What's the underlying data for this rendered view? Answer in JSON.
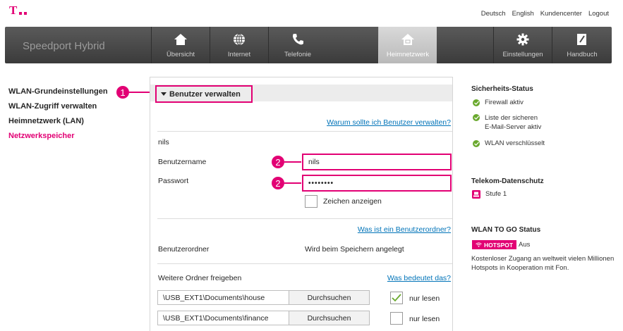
{
  "header": {
    "links": [
      "Deutsch",
      "English",
      "Kundencenter",
      "Logout"
    ]
  },
  "nav": {
    "brand": "Speedport Hybrid",
    "items": [
      {
        "label": "Übersicht",
        "icon": "home-icon"
      },
      {
        "label": "Internet",
        "icon": "globe-icon"
      },
      {
        "label": "Telefonie",
        "icon": "phone-icon"
      },
      {
        "label": "Heimnetzwerk",
        "icon": "home-network-icon",
        "active": true
      },
      {
        "label": "Einstellungen",
        "icon": "gear-icon"
      },
      {
        "label": "Handbuch",
        "icon": "book-icon"
      }
    ]
  },
  "sidebar": {
    "items": [
      {
        "label": "WLAN-Grundeinstellungen"
      },
      {
        "label": "WLAN-Zugriff verwalten"
      },
      {
        "label": "Heimnetzwerk (LAN)"
      },
      {
        "label": "Netzwerkspeicher",
        "active": true
      }
    ]
  },
  "main": {
    "section_title": "Benutzer verwalten",
    "why_link": "Warum sollte ich Benutzer verwalten?",
    "user_name_display": "nils",
    "username_label": "Benutzername",
    "username_value": "nils",
    "password_label": "Passwort",
    "password_value": "••••••••",
    "show_chars_label": "Zeichen anzeigen",
    "user_folder_link": "Was ist ein Benutzerordner?",
    "user_folder_label": "Benutzerordner",
    "user_folder_value": "Wird beim Speichern angelegt",
    "share_label": "Weitere Ordner freigeben",
    "share_link": "Was bedeutet das?",
    "folders": [
      {
        "path": "\\USB_EXT1\\Documents\\house",
        "button": "Durchsuchen",
        "readonly_label": "nur lesen",
        "readonly": true
      },
      {
        "path": "\\USB_EXT1\\Documents\\finance",
        "button": "Durchsuchen",
        "readonly_label": "nur lesen",
        "readonly": false
      }
    ],
    "callouts": [
      "1",
      "2",
      "2"
    ]
  },
  "right": {
    "security_title": "Sicherheits-Status",
    "security_items": [
      {
        "text": "Firewall aktiv"
      },
      {
        "text": "Liste der sicheren\nE-Mail-Server aktiv"
      },
      {
        "text": "WLAN verschlüsselt"
      }
    ],
    "privacy_title": "Telekom-Datenschutz",
    "privacy_level": "Stufe 1",
    "wlan_togo_title": "WLAN TO GO Status",
    "hotspot_badge": "HOTSPOT",
    "hotspot_status": "Aus",
    "hotspot_desc_1": "Kostenloser Zugang an weltweit vielen Millionen",
    "hotspot_desc_2": "Hotspots in Kooperation mit Fon."
  },
  "colors": {
    "brand": "#e20074",
    "link": "#0073b8",
    "status_ok": "#6aa92e"
  }
}
